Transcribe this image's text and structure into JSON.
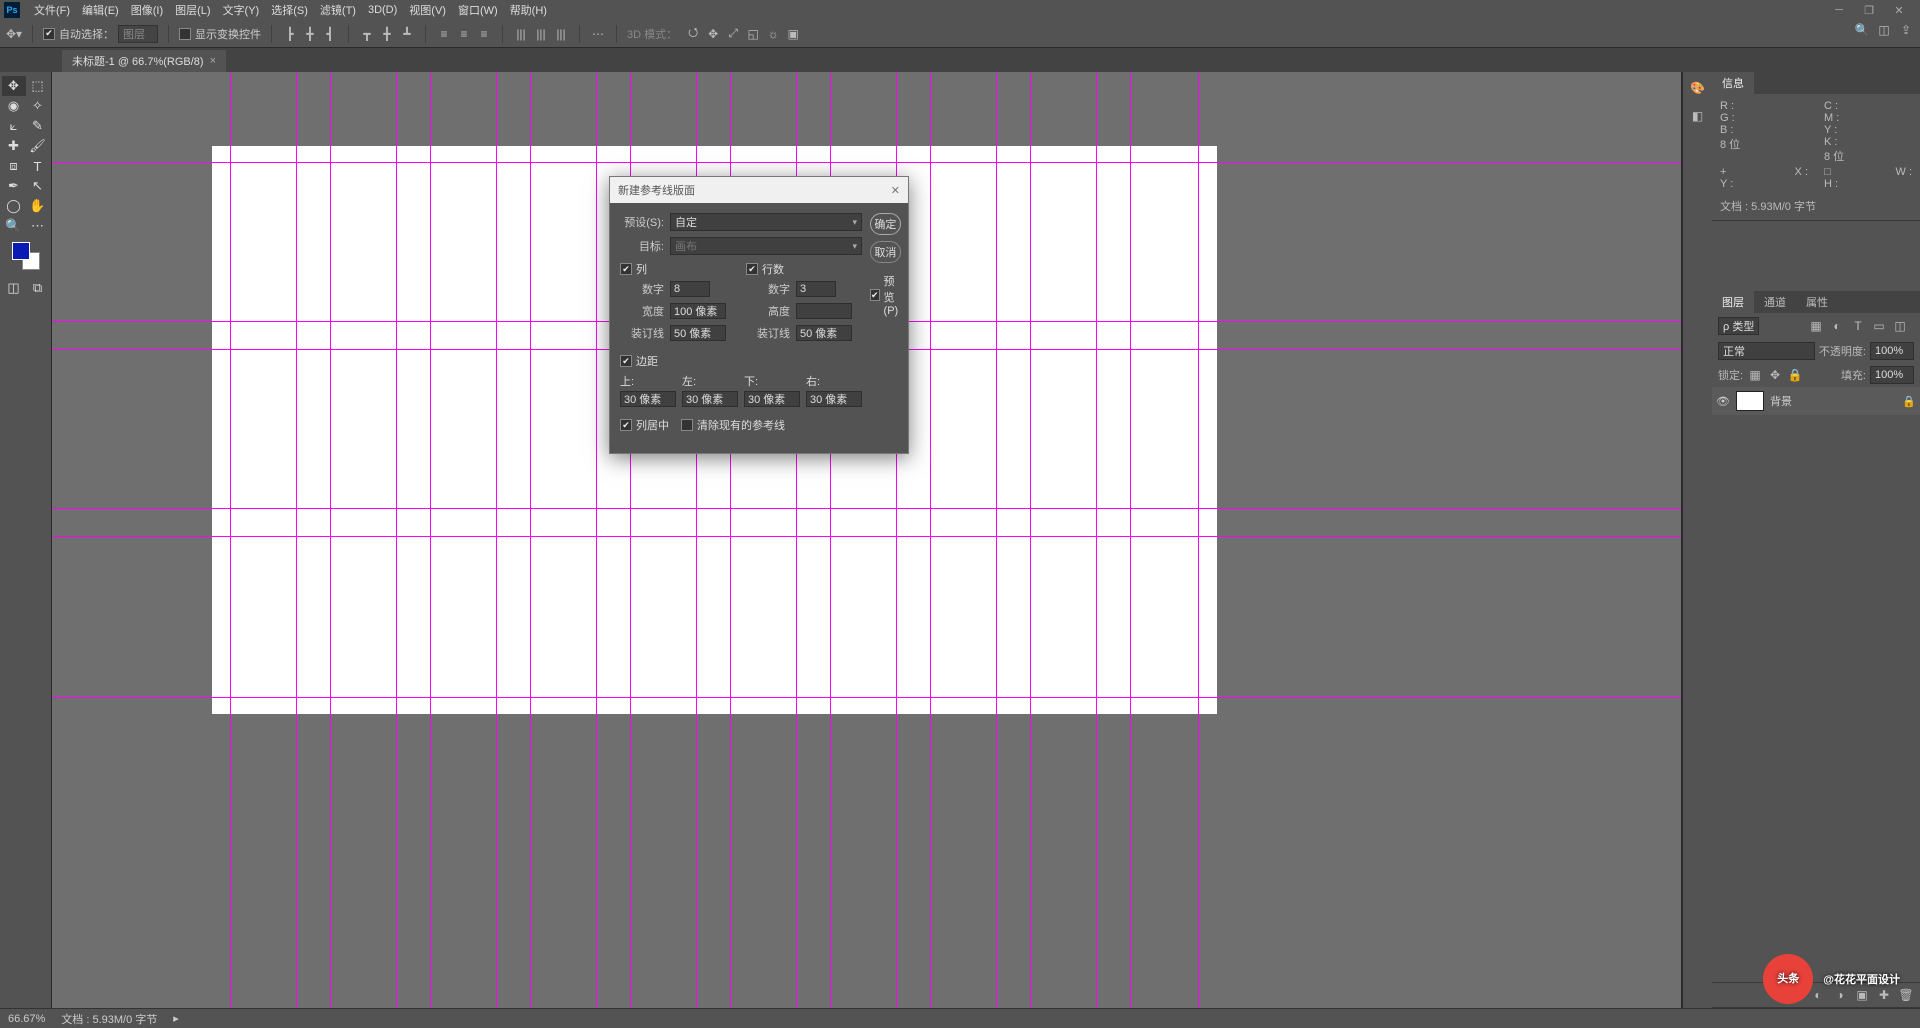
{
  "menu": {
    "items": [
      "文件(F)",
      "编辑(E)",
      "图像(I)",
      "图层(L)",
      "文字(Y)",
      "选择(S)",
      "滤镜(T)",
      "3D(D)",
      "视图(V)",
      "窗口(W)",
      "帮助(H)"
    ]
  },
  "options": {
    "auto_select": "自动选择：",
    "layer_dd": "图层",
    "show_transform": "显示变换控件",
    "mode3d": "3D 模式："
  },
  "tab": {
    "title": "未标题-1 @ 66.7%(RGB/8)"
  },
  "dialog": {
    "title": "新建参考线版面",
    "preset_label": "预设(S):",
    "preset_value": "自定",
    "target_label": "目标:",
    "target_value": "画布",
    "ok": "确定",
    "cancel": "取消",
    "preview": "预览(P)",
    "columns": {
      "cb": "列",
      "count_label": "数字",
      "count": "8",
      "width_label": "宽度",
      "width": "100 像素",
      "gutter_label": "装订线",
      "gutter": "50 像素"
    },
    "rows": {
      "cb": "行数",
      "count_label": "数字",
      "count": "3",
      "height_label": "高度",
      "height": "",
      "gutter_label": "装订线",
      "gutter": "50 像素"
    },
    "margins": {
      "cb": "边距",
      "top": "上:",
      "left": "左:",
      "bottom": "下:",
      "right": "右:",
      "val": "30 像素"
    },
    "center": "列居中",
    "clear": "清除现有的参考线"
  },
  "info_panel": {
    "tab": "信息",
    "r": "R :",
    "g": "G :",
    "b": "B :",
    "c": "C :",
    "m": "M :",
    "y": "Y :",
    "k": "K :",
    "bit": "8 位",
    "x": "X :",
    "yp": "Y :",
    "w": "W :",
    "h": "H :",
    "doc": "文档 : 5.93M/0 字节"
  },
  "layers_panel": {
    "tabs": [
      "图层",
      "通道",
      "属性"
    ],
    "search_ph": "ρ 类型",
    "blend": "正常",
    "opacity_l": "不透明度:",
    "opacity": "100%",
    "lock_l": "锁定:",
    "fill_l": "填充:",
    "fill": "100%",
    "bg_layer": "背景"
  },
  "status": {
    "zoom": "66.67%",
    "doc": "文档 : 5.93M/0 字节"
  },
  "watermark": {
    "brand": "头条",
    "author": "@花花平面设计"
  }
}
